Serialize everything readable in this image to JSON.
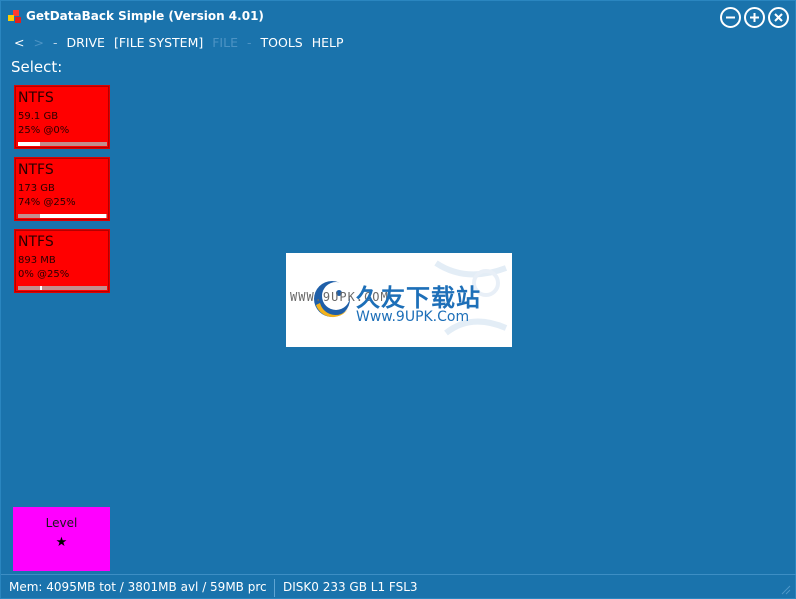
{
  "app": {
    "title": "GetDataBack Simple (Version 4.01)"
  },
  "window_controls": {
    "minimize_icon": "minus-circle",
    "maximize_icon": "plus-circle",
    "close_icon": "x-circle"
  },
  "menu": {
    "back": "<",
    "forward": ">",
    "sep1": "-",
    "drive": "DRIVE",
    "file_system": "[FILE SYSTEM]",
    "file": "FILE",
    "sep2": "-",
    "tools": "TOOLS",
    "help": "HELP"
  },
  "select_label": "Select:",
  "drives": [
    {
      "fs": "NTFS",
      "size": "59.1 GB",
      "usage": "25% @0%",
      "used_fraction": 0.25,
      "marker_fraction": 0.0
    },
    {
      "fs": "NTFS",
      "size": "173 GB",
      "usage": "74% @25%",
      "used_fraction": 0.74,
      "marker_fraction": 0.25
    },
    {
      "fs": "NTFS",
      "size": "893 MB",
      "usage": "0% @25%",
      "used_fraction": 0.0,
      "marker_fraction": 0.25
    }
  ],
  "watermark": {
    "www": "WWW.9UPK.COM",
    "cn": "久友下载站",
    "url": "Www.9UPK.Com"
  },
  "level": {
    "label": "Level",
    "stars": "★"
  },
  "status": {
    "mem": "Mem: 4095MB tot / 3801MB avl / 59MB prc",
    "disk": "DISK0 233 GB L1 FSL3"
  },
  "colors": {
    "background": "#1a73ac",
    "tile": "#ff0000",
    "level": "#ff00ff",
    "text": "#ffffff"
  }
}
